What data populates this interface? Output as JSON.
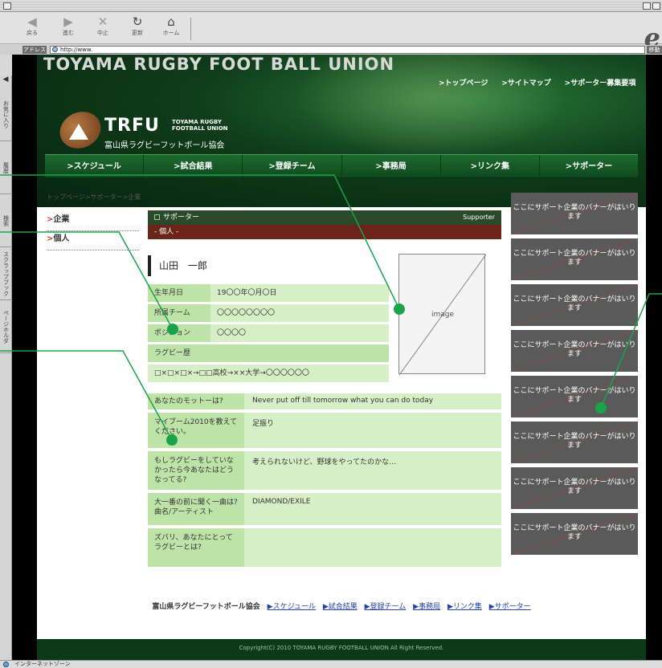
{
  "browser": {
    "toolbar": [
      {
        "label": "戻る",
        "glyph": "◀",
        "on": false
      },
      {
        "label": "進む",
        "glyph": "▶",
        "on": false
      },
      {
        "label": "中止",
        "glyph": "✕",
        "on": false
      },
      {
        "label": "更新",
        "glyph": "↻",
        "on": true
      },
      {
        "label": "ホーム",
        "glyph": "⌂",
        "on": true
      }
    ],
    "address_label": "アドレス",
    "address_value": "http://www.",
    "go_label": "移動",
    "sidebar_tabs": [
      "お気に入り",
      "履歴",
      "検索",
      "スクラップブック",
      "ページホルダ"
    ],
    "status_text": "インターネットゾーン",
    "brand_glyph": "e"
  },
  "site": {
    "title": "TOYAMA RUGBY FOOT BALL UNION",
    "top_nav": [
      ">トップページ",
      ">サイトマップ",
      ">サポーター募集要項"
    ],
    "logo": {
      "short": "TRFU",
      "sub_line1": "TOYAMA RUGBY",
      "sub_line2": "FOOTBALL UNION",
      "ja": "富山県ラグビーフットボール協会"
    },
    "main_nav": [
      ">スケジュール",
      ">試合結果",
      ">登録チーム",
      ">事務局",
      ">リンク集",
      ">サポーター"
    ]
  },
  "breadcrumb": "トップページ>サポーター>企業",
  "left_nav": [
    {
      "marker": ">",
      "label": "企業"
    },
    {
      "marker": ">",
      "label": "個人"
    }
  ],
  "section": {
    "title": "サポーター",
    "title_en": "Supporter",
    "subtitle": "- 個人 -"
  },
  "profile": {
    "name": "山田　一郎",
    "rows": [
      {
        "key": "生年月日",
        "value": "19〇〇年〇月〇日"
      },
      {
        "key": "所属チーム",
        "value": "〇〇〇〇〇〇〇〇"
      },
      {
        "key": "ポジション",
        "value": "〇〇〇〇"
      }
    ],
    "history_label": "ラグビー歴",
    "history_value": "□×□×□×→□□高校→××大学→〇〇〇〇〇〇",
    "image_label": "image"
  },
  "qa": [
    {
      "q": "あなたのモットーは?",
      "a": "Never put off till tomorrow what you can do today"
    },
    {
      "q": "マイブーム2010を教えてください。",
      "a": "足振り"
    },
    {
      "q": "もしラグビーをしていなかったら今あなたはどうなってる?",
      "a": "考えられないけど、野球をやってたのかな…"
    },
    {
      "q": "大一番の前に聞く一曲は?曲名/アーティスト",
      "a": "DIAMOND/EXILE"
    },
    {
      "q": "ズバリ、あなたにとってラグビーとは?",
      "a": ""
    }
  ],
  "banners": [
    "ここにサポート企業のバナーがはいります",
    "ここにサポート企業のバナーがはいります",
    "ここにサポート企業のバナーがはいります",
    "ここにサポート企業のバナーがはいります",
    "ここにサポート企業のバナーがはいります",
    "ここにサポート企業のバナーがはいります",
    "ここにサポート企業のバナーがはいります",
    "ここにサポート企業のバナーがはいります"
  ],
  "footer": {
    "org": "富山県ラグビーフットボール協会",
    "links": [
      "▶スケジュール",
      "▶試合結果",
      "▶登録チーム",
      "▶事務局",
      "▶リンク集",
      "▶サポーター"
    ],
    "copyright": "Copyright(C) 2010 TOYAMA RUGBY FOOTBALL UNION All Right Reserved."
  },
  "colors": {
    "callout": "#1aa34a",
    "header_green": "#0f3d1a",
    "cell_light": "#d7efc6",
    "cell_dark": "#bde3a8",
    "section_head": "#2a4a2a",
    "section_sub": "#6b2418",
    "banner": "#5a5a5a"
  }
}
